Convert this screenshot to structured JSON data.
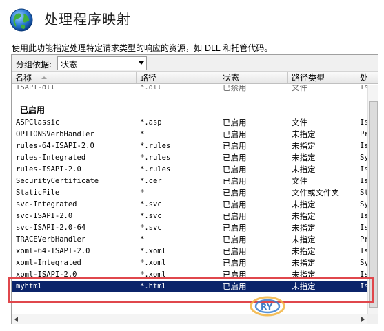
{
  "header": {
    "title": "处理程序映射",
    "icon": "globe-icon"
  },
  "description": "使用此功能指定处理特定请求类型的响应的资源，如 DLL 和托管代码。",
  "group_by": {
    "label": "分组依据:",
    "value": "状态"
  },
  "columns": [
    "名称",
    "路径",
    "状态",
    "路径类型",
    "处"
  ],
  "partial_row": {
    "name": "ISAPI-dll",
    "path": "*.dll",
    "state": "已禁用",
    "type": "文件",
    "handler": "Is"
  },
  "group_heading": "已启用",
  "rows": [
    {
      "name": "ASPClassic",
      "path": "*.asp",
      "state": "已启用",
      "type": "文件",
      "handler": "Is"
    },
    {
      "name": "OPTIONSVerbHandler",
      "path": "*",
      "state": "已启用",
      "type": "未指定",
      "handler": "Pr"
    },
    {
      "name": "rules-64-ISAPI-2.0",
      "path": "*.rules",
      "state": "已启用",
      "type": "未指定",
      "handler": "Is"
    },
    {
      "name": "rules-Integrated",
      "path": "*.rules",
      "state": "已启用",
      "type": "未指定",
      "handler": "Sy"
    },
    {
      "name": "rules-ISAPI-2.0",
      "path": "*.rules",
      "state": "已启用",
      "type": "未指定",
      "handler": "Is"
    },
    {
      "name": "SecurityCertificate",
      "path": "*.cer",
      "state": "已启用",
      "type": "文件",
      "handler": "Is"
    },
    {
      "name": "StaticFile",
      "path": "*",
      "state": "已启用",
      "type": "文件或文件夹",
      "handler": "St"
    },
    {
      "name": "svc-Integrated",
      "path": "*.svc",
      "state": "已启用",
      "type": "未指定",
      "handler": "Sy"
    },
    {
      "name": "svc-ISAPI-2.0",
      "path": "*.svc",
      "state": "已启用",
      "type": "未指定",
      "handler": "Is"
    },
    {
      "name": "svc-ISAPI-2.0-64",
      "path": "*.svc",
      "state": "已启用",
      "type": "未指定",
      "handler": "Is"
    },
    {
      "name": "TRACEVerbHandler",
      "path": "*",
      "state": "已启用",
      "type": "未指定",
      "handler": "Pr"
    },
    {
      "name": "xoml-64-ISAPI-2.0",
      "path": "*.xoml",
      "state": "已启用",
      "type": "未指定",
      "handler": "Is"
    },
    {
      "name": "xoml-Integrated",
      "path": "*.xoml",
      "state": "已启用",
      "type": "未指定",
      "handler": "Sy"
    },
    {
      "name": "xoml-ISAPI-2.0",
      "path": "*.xoml",
      "state": "已启用",
      "type": "未指定",
      "handler": "Is"
    },
    {
      "name": "myhtml",
      "path": "*.html",
      "state": "已启用",
      "type": "未指定",
      "handler": "Is"
    }
  ],
  "selected_row": "myhtml",
  "colors": {
    "selection": "#0b246a",
    "highlight_box": "#e0474c"
  }
}
